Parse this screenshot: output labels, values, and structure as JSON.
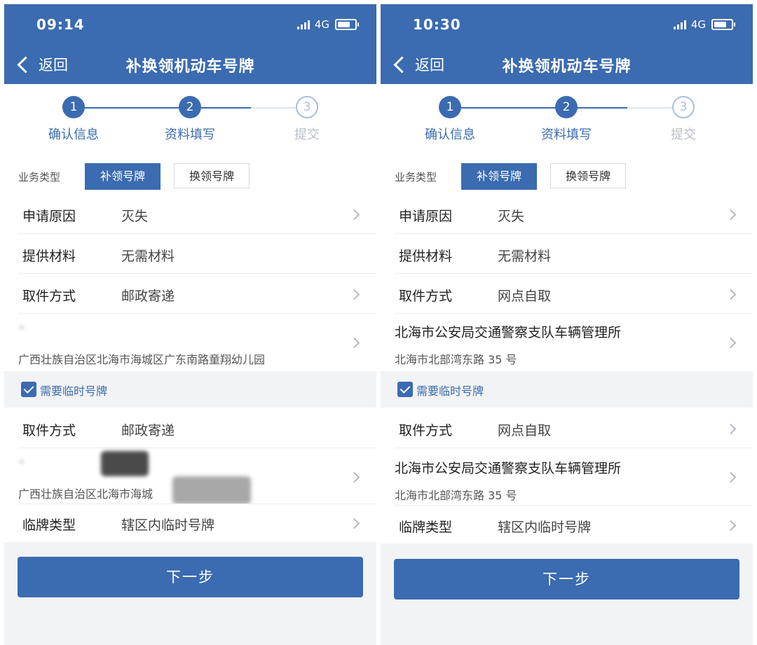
{
  "colors": {
    "primary": "#3b6bb0",
    "background": "#f2f3f5",
    "inactive_step": "#a9bfdc"
  },
  "icons": [
    "signal-icon",
    "battery-icon",
    "back-chevron-icon",
    "chevron-right-icon",
    "checkbox-icon"
  ],
  "screens": [
    {
      "status": {
        "time": "09:14",
        "network": "4G"
      },
      "nav": {
        "back_label": "返回",
        "title": "补换领机动车号牌"
      },
      "steps": [
        {
          "num": "1",
          "label": "确认信息"
        },
        {
          "num": "2",
          "label": "资料填写"
        },
        {
          "num": "3",
          "label": "提交"
        }
      ],
      "business": {
        "label": "业务类型",
        "option_selected": "补领号牌",
        "option_other": "换领号牌"
      },
      "form": {
        "reason": {
          "label": "申请原因",
          "value": "灭失"
        },
        "materials": {
          "label": "提供材料",
          "value": "无需材料"
        },
        "pickup": {
          "label": "取件方式",
          "value": "邮政寄递"
        },
        "pickup_address": {
          "name": "*",
          "detail": "广西壮族自治区北海市海城区广东南路童翔幼儿园"
        },
        "temp_check": {
          "label": "需要临时号牌",
          "checked": true
        },
        "temp_pickup": {
          "label": "取件方式",
          "value": "邮政寄递"
        },
        "temp_address": {
          "name": "*",
          "detail": "广西壮族自治区北海市海城"
        },
        "temp_type": {
          "label": "临牌类型",
          "value": "辖区内临时号牌"
        }
      },
      "next_label": "下一步"
    },
    {
      "status": {
        "time": "10:30",
        "network": "4G"
      },
      "nav": {
        "back_label": "返回",
        "title": "补换领机动车号牌"
      },
      "steps": [
        {
          "num": "1",
          "label": "确认信息"
        },
        {
          "num": "2",
          "label": "资料填写"
        },
        {
          "num": "3",
          "label": "提交"
        }
      ],
      "business": {
        "label": "业务类型",
        "option_selected": "补领号牌",
        "option_other": "换领号牌"
      },
      "form": {
        "reason": {
          "label": "申请原因",
          "value": "灭失"
        },
        "materials": {
          "label": "提供材料",
          "value": "无需材料"
        },
        "pickup": {
          "label": "取件方式",
          "value": "网点自取"
        },
        "pickup_address": {
          "name": "北海市公安局交通警察支队车辆管理所",
          "detail": "北海市北部湾东路 35 号"
        },
        "temp_check": {
          "label": "需要临时号牌",
          "checked": true
        },
        "temp_pickup": {
          "label": "取件方式",
          "value": "网点自取"
        },
        "temp_address": {
          "name": "北海市公安局交通警察支队车辆管理所",
          "detail": "北海市北部湾东路 35 号"
        },
        "temp_type": {
          "label": "临牌类型",
          "value": "辖区内临时号牌"
        }
      },
      "next_label": "下一步"
    }
  ]
}
